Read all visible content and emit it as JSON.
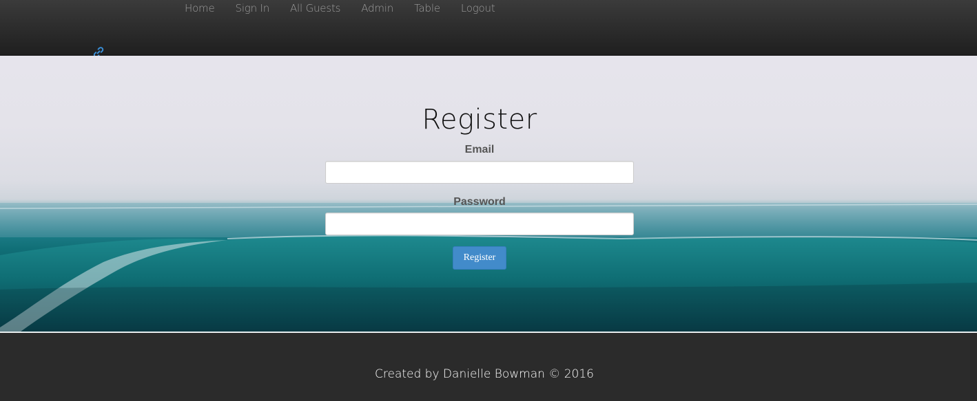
{
  "nav": {
    "items": [
      {
        "label": "Home"
      },
      {
        "label": "Sign In"
      },
      {
        "label": "All Guests"
      },
      {
        "label": "Admin"
      },
      {
        "label": "Table"
      },
      {
        "label": "Logout"
      }
    ],
    "brand_icon": "link-icon"
  },
  "form": {
    "title": "Register",
    "email_label": "Email",
    "email_value": "",
    "email_placeholder": "",
    "password_label": "Password",
    "password_value": "",
    "password_placeholder": "",
    "submit_label": "Register"
  },
  "footer": {
    "text": "Created by Danielle Bowman © 2016"
  },
  "colors": {
    "navbar": "#2e2e2e",
    "nav_link": "#9d9d9d",
    "button": "#428bca",
    "brand_icon": "#3a8fd8",
    "footer": "#2b2b2b"
  }
}
